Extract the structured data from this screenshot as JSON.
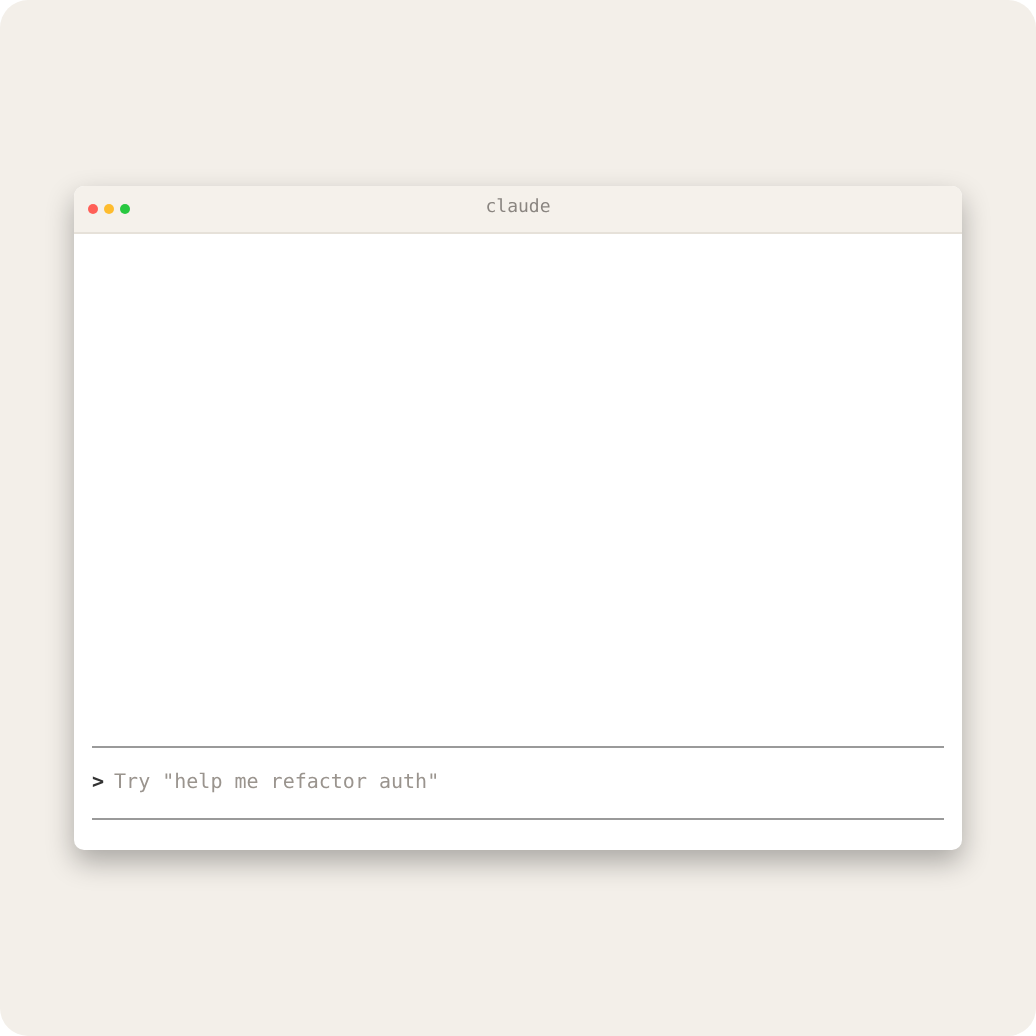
{
  "window": {
    "title": "claude"
  },
  "prompt": {
    "symbol": ">",
    "placeholder": "Try \"help me refactor auth\""
  }
}
